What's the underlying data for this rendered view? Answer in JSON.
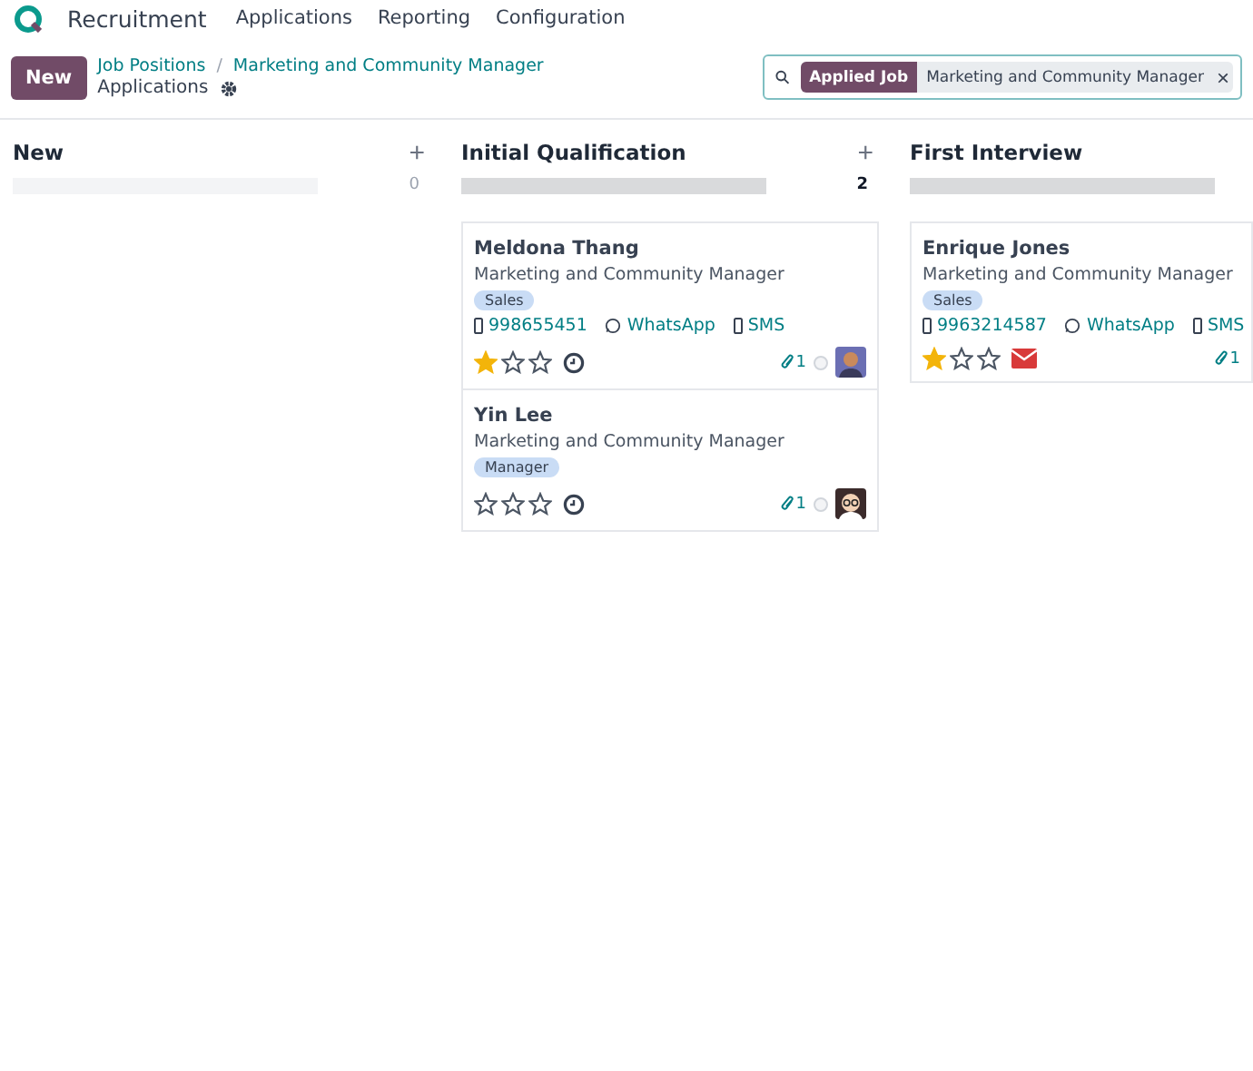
{
  "nav": {
    "app": "Recruitment",
    "menu": [
      "Applications",
      "Reporting",
      "Configuration"
    ]
  },
  "control": {
    "new_button": "New",
    "breadcrumbs": [
      "Job Positions",
      "Marketing and Community Manager"
    ],
    "separator": "/",
    "page": "Applications",
    "search": {
      "facet_label": "Applied Job",
      "facet_value": "Marketing and Community Manager",
      "remove": "×"
    }
  },
  "columns": [
    {
      "title": "New",
      "add": "+",
      "count": "0",
      "progress": {
        "level": 0
      }
    },
    {
      "title": "Initial Qualification",
      "add": "+",
      "count": "2",
      "progress": {
        "level": 1
      },
      "cards": [
        {
          "name": "Meldona Thang",
          "job": "Marketing and Community Manager",
          "tag": "Sales",
          "phone": "998655451",
          "whatsapp": "WhatsApp",
          "sms": "SMS",
          "stars": 1,
          "activity": {
            "kind": "clock"
          },
          "attachments": "1",
          "avatar": {
            "kind": "man"
          }
        },
        {
          "name": "Yin Lee",
          "job": "Marketing and Community Manager",
          "tag": "Manager",
          "stars": 0,
          "activity": {
            "kind": "clock"
          },
          "attachments": "1",
          "avatar": {
            "kind": "glasses"
          }
        }
      ]
    },
    {
      "title": "First Interview",
      "progress": {
        "level": 1
      },
      "cards": [
        {
          "name": "Enrique Jones",
          "job": "Marketing and Community Manager",
          "tag": "Sales",
          "phone": "9963214587",
          "whatsapp": "WhatsApp",
          "sms": "SMS",
          "stars": 1,
          "activity": {
            "kind": "mail"
          },
          "attachments": "1"
        }
      ]
    }
  ]
}
